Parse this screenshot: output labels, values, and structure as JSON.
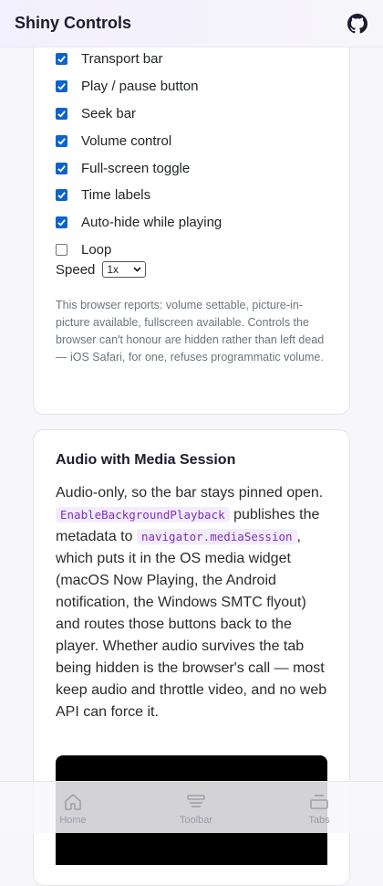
{
  "header": {
    "title": "Shiny Controls",
    "github_icon": "github-icon"
  },
  "controls_card": {
    "options": [
      {
        "label": "Transport bar",
        "checked": true
      },
      {
        "label": "Play / pause button",
        "checked": true
      },
      {
        "label": "Seek bar",
        "checked": true
      },
      {
        "label": "Volume control",
        "checked": true
      },
      {
        "label": "Full-screen toggle",
        "checked": true
      },
      {
        "label": "Time labels",
        "checked": true
      },
      {
        "label": "Auto-hide while playing",
        "checked": true
      },
      {
        "label": "Loop",
        "checked": false
      }
    ],
    "speed_label": "Speed",
    "speed_value": "1x",
    "note": "This browser reports: volume settable, picture-in-picture available, fullscreen available. Controls the browser can't honour are hidden rather than left dead — iOS Safari, for one, refuses programmatic volume."
  },
  "audio_card": {
    "title": "Audio with Media Session",
    "text_1": "Audio-only, so the bar stays pinned open.",
    "code_1": "EnableBackgroundPlayback",
    "text_2": "publishes the metadata to",
    "code_2": "navigator.mediaSession",
    "text_3": ", which puts it in the OS media widget (macOS Now Playing, the Android notification, the Windows SMTC flyout) and routes those buttons back to the player. Whether audio survives the tab being hidden is the browser's call — most keep audio and throttle video, and no web API can force it."
  },
  "bottom_nav": {
    "items": [
      {
        "label": "Home",
        "icon": "home-icon"
      },
      {
        "label": "Toolbar",
        "icon": "toolbar-icon"
      },
      {
        "label": "Tabs",
        "icon": "tabs-icon"
      }
    ]
  },
  "colors": {
    "accent": "#0b63ce",
    "code_bg": "#f3ecfc",
    "code_fg": "#7b2fbf"
  }
}
